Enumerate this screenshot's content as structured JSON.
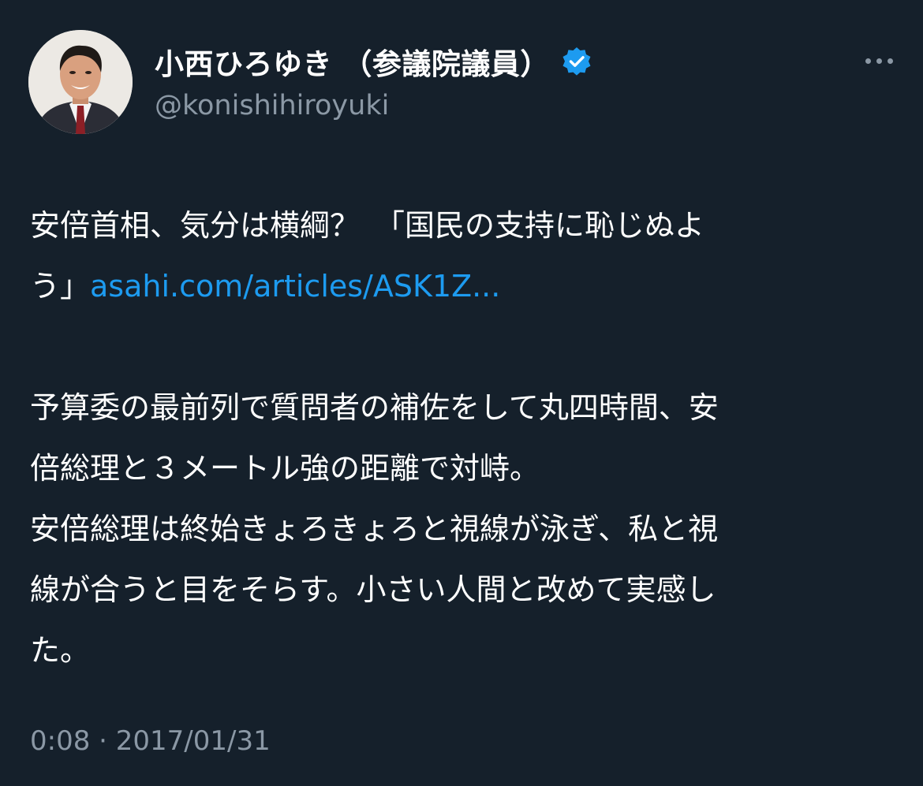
{
  "author": {
    "display_name": "小西ひろゆき （参議院議員）",
    "handle": "@konishihiroyuki",
    "verified": true
  },
  "tweet": {
    "line1": "安倍首相、気分は横綱？　「国民の支持に恥じぬよ",
    "line2_text": "う」",
    "link_text": "asahi.com/articles/ASK1Z...",
    "line3": "予算委の最前列で質問者の補佐をして丸四時間、安",
    "line4": "倍総理と３メートル強の距離で対峙。",
    "line5": "安倍総理は終始きょろきょろと視線が泳ぎ、私と視",
    "line6": "線が合うと目をそらす。小さい人間と改めて実感し",
    "line7": "た。"
  },
  "meta": {
    "timestamp": "0:08 · 2017/01/31"
  },
  "icons": {
    "verified": "verified-badge-icon",
    "more": "more-options-icon"
  },
  "colors": {
    "background": "#15202b",
    "text": "#ffffff",
    "secondary": "#8b98a5",
    "link": "#1d9bf0",
    "verified": "#1d9bf0"
  }
}
